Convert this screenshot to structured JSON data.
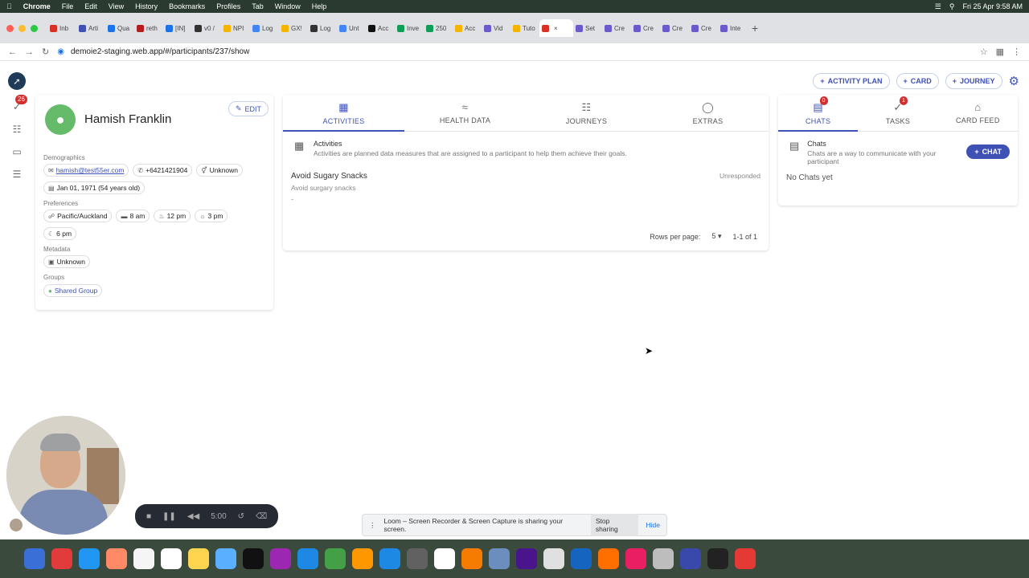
{
  "menubar": {
    "app": "Chrome",
    "items": [
      "File",
      "Edit",
      "View",
      "History",
      "Bookmarks",
      "Profiles",
      "Tab",
      "Window",
      "Help"
    ],
    "datetime": "Fri 25 Apr 9:58 AM"
  },
  "browser_tabs": [
    {
      "label": "Inb",
      "color": "#d93025"
    },
    {
      "label": "Arti",
      "color": "#3f51b5"
    },
    {
      "label": "Qua",
      "color": "#1a73e8"
    },
    {
      "label": "reth",
      "color": "#b71c1c"
    },
    {
      "label": "[IN]",
      "color": "#1a73e8"
    },
    {
      "label": "v0 /",
      "color": "#333333"
    },
    {
      "label": "NPI",
      "color": "#f4b400"
    },
    {
      "label": "Log",
      "color": "#4285f4"
    },
    {
      "label": "GX!",
      "color": "#f4b400"
    },
    {
      "label": "Loɡ",
      "color": "#333333"
    },
    {
      "label": "Unt",
      "color": "#4285f4"
    },
    {
      "label": "Acc",
      "color": "#111111"
    },
    {
      "label": "Inve",
      "color": "#0f9d58"
    },
    {
      "label": "250",
      "color": "#0f9d58"
    },
    {
      "label": "Acc",
      "color": "#f4b400"
    },
    {
      "label": "Vid",
      "color": "#6a5acd"
    },
    {
      "label": "Tuto",
      "color": "#f4b400"
    },
    {
      "label": "",
      "color": "#d93025",
      "active": true
    },
    {
      "label": "Set",
      "color": "#6a5acd"
    },
    {
      "label": "Cre",
      "color": "#6a5acd"
    },
    {
      "label": "Cre",
      "color": "#6a5acd"
    },
    {
      "label": "Cre",
      "color": "#6a5acd"
    },
    {
      "label": "Cre",
      "color": "#6a5acd"
    },
    {
      "label": "Inte",
      "color": "#6a5acd"
    }
  ],
  "address": {
    "url": "demoie2-staging.web.app/#/participants/237/show"
  },
  "rail": {
    "notification_count": "26"
  },
  "toolbar": {
    "activity_plan": "ACTIVITY PLAN",
    "card": "CARD",
    "journey": "JOURNEY"
  },
  "profile": {
    "name": "Hamish Franklin",
    "edit": "EDIT",
    "demographics_label": "Demographics",
    "email": "hamish@test55er.com",
    "phone": "+6421421904",
    "gender": "Unknown",
    "dob": "Jan 01, 1971 (54 years old)",
    "preferences_label": "Preferences",
    "timezone": "Pacific/Auckland",
    "wake_time": "8 am",
    "lunch_time": "12 pm",
    "afternoon_time": "3 pm",
    "evening_time": "6 pm",
    "metadata_label": "Metadata",
    "metadata_value": "Unknown",
    "groups_label": "Groups",
    "group": "Shared Group"
  },
  "main_tabs": {
    "activities": "ACTIVITIES",
    "health_data": "HEALTH DATA",
    "journeys": "JOURNEYS",
    "extras": "EXTRAS"
  },
  "activities": {
    "info_title": "Activities",
    "info_desc": "Activities are planned data measures that are assigned to a participant to help them achieve their goals.",
    "item_title": "Avoid Sugary Snacks",
    "item_subtitle": "Avoid surgary snacks",
    "item_extra": "-",
    "item_status": "Unresponded",
    "rows_label": "Rows per page:",
    "rows_value": "5",
    "range": "1-1 of 1"
  },
  "side_tabs": {
    "chats": "CHATS",
    "chats_badge": "0",
    "tasks": "TASKS",
    "tasks_badge": "1",
    "card_feed": "CARD FEED"
  },
  "chats": {
    "info_title": "Chats",
    "info_desc": "Chats are a way to communicate with your participant",
    "chat_button": "CHAT",
    "empty": "No Chats yet"
  },
  "loom": {
    "timer": "5:00",
    "message": "Loom – Screen Recorder & Screen Capture is sharing your screen.",
    "stop": "Stop sharing",
    "hide": "Hide"
  },
  "dock_colors": [
    "#3b6fd8",
    "#e23b3b",
    "#2196f3",
    "#ff8a65",
    "#f5f5f5",
    "#ffffff",
    "#ffd54f",
    "#5ab0ff",
    "#111111",
    "#9c27b0",
    "#1e88e5",
    "#43a047",
    "#ff9800",
    "#1e88e5",
    "#616161",
    "#ffffff",
    "#f57c00",
    "#6c8ebf",
    "#4a148c",
    "#e0e0e0",
    "#1565c0",
    "#ff6f00",
    "#e91e63",
    "#bdbdbd",
    "#3949ab",
    "#222222",
    "#e53935"
  ]
}
